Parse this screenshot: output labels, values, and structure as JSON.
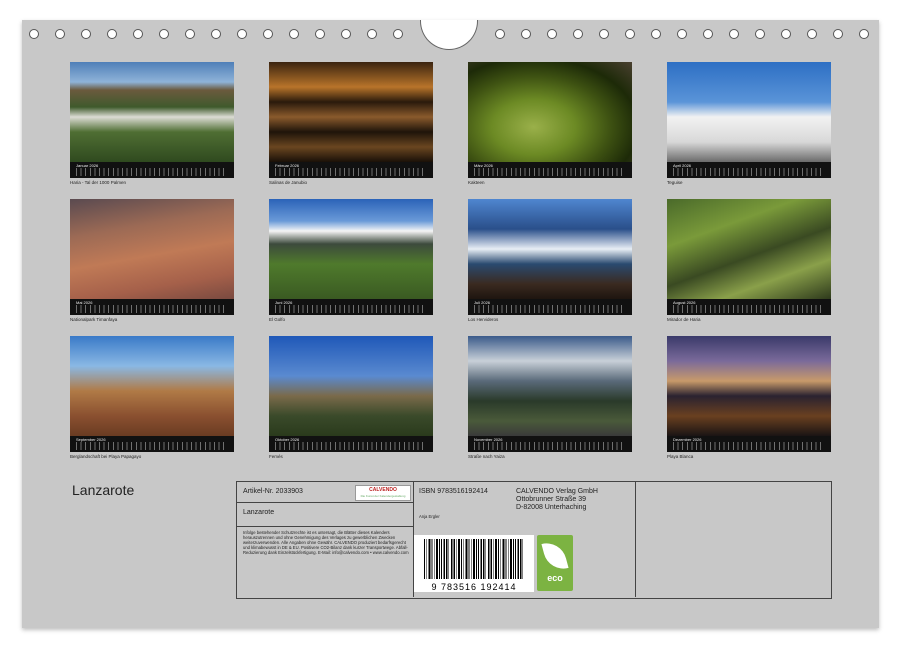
{
  "calendar": {
    "title": "Lanzarote",
    "months": [
      {
        "month": "Januar",
        "year": "2026",
        "caption": "Haria - Tal der 1000 Palmen"
      },
      {
        "month": "Februar",
        "year": "2026",
        "caption": "Salinas de Janubio"
      },
      {
        "month": "März",
        "year": "2026",
        "caption": "Kakteen"
      },
      {
        "month": "April",
        "year": "2026",
        "caption": "Teguise"
      },
      {
        "month": "Mai",
        "year": "2026",
        "caption": "Nationalpark Timanfaya"
      },
      {
        "month": "Juni",
        "year": "2026",
        "caption": "El Golfo"
      },
      {
        "month": "Juli",
        "year": "2026",
        "caption": "Los Hervideros"
      },
      {
        "month": "August",
        "year": "2026",
        "caption": "Mirador de Haria"
      },
      {
        "month": "September",
        "year": "2026",
        "caption": "Berglandschaft bei Playa Papagayo"
      },
      {
        "month": "Oktober",
        "year": "2026",
        "caption": "Femés"
      },
      {
        "month": "November",
        "year": "2026",
        "caption": "Straße nach Yaiza"
      },
      {
        "month": "Dezember",
        "year": "2026",
        "caption": "Playa Blanca"
      }
    ]
  },
  "info": {
    "article": "Artikel-Nr. 2033903",
    "product_title": "Lanzarote",
    "logo_text": "CALVENDO",
    "logo_sub": "Die Kunst der Kalendergestaltung",
    "legal": "Infolge bestehender Schutzrechte ist es untersagt, die Blätter dieses Kalenders herauszutrennen und ohne Genehmigung des Verlages zu gewerblichen Zwecken weiterzuverwenden. Alle Angaben ohne Gewähr. CALVENDO produziert bedarfsgerecht und klimabewusst in DE & EU. Positivere CO2-Bilanz dank kurzer Transportwege. Abfall-Reduzierung dank Einzelstückfertigung. E-Mail: info@calvendo.com • www.calvendo.com",
    "isbn": "ISBN 9783516192414",
    "author": "Anja Ergler",
    "publisher_name": "CALVENDO Verlag GmbH",
    "publisher_street": "Ottobrunner Straße 39",
    "publisher_city": "D-82008 Unterhaching",
    "barcode_number": "9 783516 192414",
    "eco_label": "eco"
  },
  "colors": {
    "sheet": "#c8c8c8",
    "eco": "#7cb342"
  }
}
